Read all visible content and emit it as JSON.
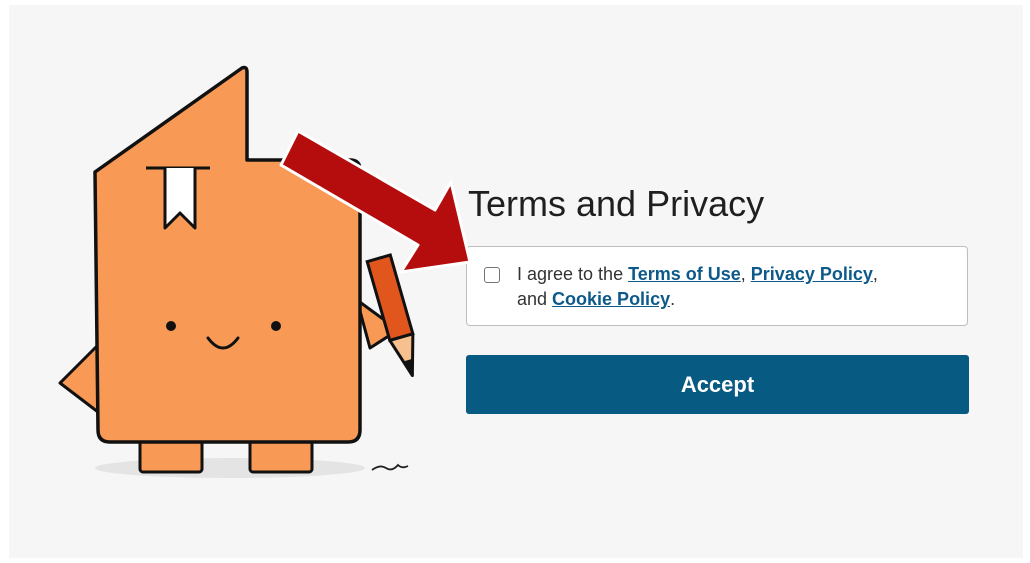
{
  "heading": "Terms and Privacy",
  "agreement": {
    "prefix": "I agree to the ",
    "terms_link": "Terms of Use",
    "sep1": ", ",
    "privacy_link": "Privacy Policy",
    "sep2": ",",
    "and_text": " and ",
    "cookie_link": "Cookie Policy",
    "suffix": ".",
    "checked": false
  },
  "accept_button": "Accept",
  "icons": {
    "mascot": "orange-book-mascot-with-pencil",
    "annotation": "red-arrow-pointing-to-checkbox"
  },
  "colors": {
    "accent_button": "#075b82",
    "link": "#0d5a8a",
    "mascot_orange": "#f89a55",
    "arrow_red": "#b50d0d"
  }
}
